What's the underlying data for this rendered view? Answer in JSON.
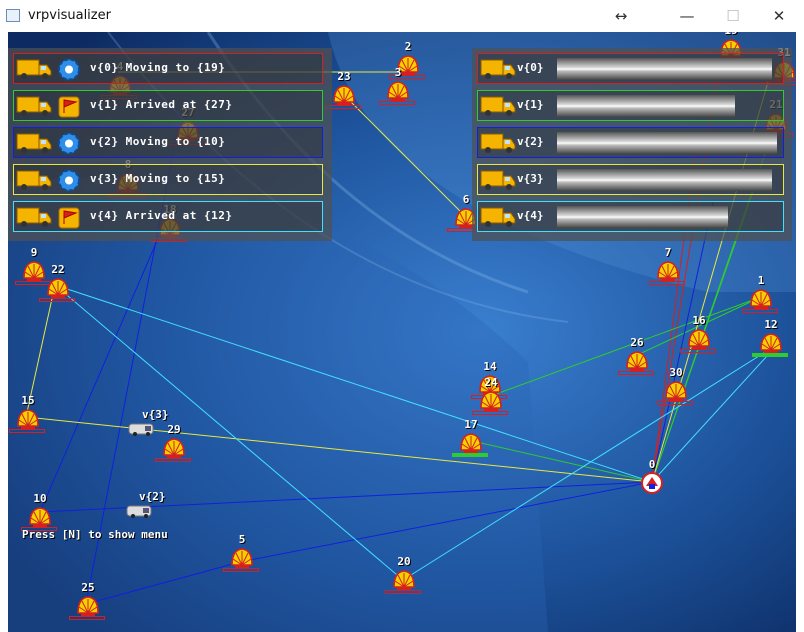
{
  "window": {
    "title": "vrpvisualizer",
    "resize_glyph": "↔",
    "minimize_glyph": "—",
    "maximize_glyph": "☐",
    "close_glyph": "✕"
  },
  "colors": {
    "background": "#1b4f97",
    "red": "#d42020",
    "green": "#2ecc2e",
    "blue": "#1020e0",
    "yellow": "#e8e840",
    "cyan": "#40e0ff",
    "white": "#ffffff"
  },
  "status_panel": {
    "rows": [
      {
        "text": "v{0} Moving to {19}",
        "state_icon": "gear-icon",
        "border": "#d42020"
      },
      {
        "text": "v{1} Arrived at {27}",
        "state_icon": "flag-icon",
        "border": "#2ecc2e"
      },
      {
        "text": "v{2} Moving to {10}",
        "state_icon": "gear-icon",
        "border": "#1020e0"
      },
      {
        "text": "v{3} Moving to {15}",
        "state_icon": "gear-icon",
        "border": "#e8e840"
      },
      {
        "text": "v{4} Arrived at {12}",
        "state_icon": "flag-icon",
        "border": "#40e0ff"
      }
    ]
  },
  "progress_panel": {
    "rows": [
      {
        "text": "v{0}",
        "progress": 0.97,
        "border": "#d42020"
      },
      {
        "text": "v{1}",
        "progress": 0.8,
        "border": "#2ecc2e"
      },
      {
        "text": "v{2}",
        "progress": 0.99,
        "border": "#1020e0"
      },
      {
        "text": "v{3}",
        "progress": 0.97,
        "border": "#e8e840"
      },
      {
        "text": "v{4}",
        "progress": 0.77,
        "border": "#40e0ff"
      }
    ]
  },
  "depot": {
    "label": "0"
  },
  "customers": [
    {
      "id": "2"
    },
    {
      "id": "3"
    },
    {
      "id": "4"
    },
    {
      "id": "23"
    },
    {
      "id": "8"
    },
    {
      "id": "18"
    },
    {
      "id": "6"
    },
    {
      "id": "9"
    },
    {
      "id": "22"
    },
    {
      "id": "15"
    },
    {
      "id": "29"
    },
    {
      "id": "10"
    },
    {
      "id": "25"
    },
    {
      "id": "5"
    },
    {
      "id": "20"
    },
    {
      "id": "14"
    },
    {
      "id": "24"
    },
    {
      "id": "7"
    },
    {
      "id": "1"
    },
    {
      "id": "16"
    },
    {
      "id": "26"
    },
    {
      "id": "30"
    },
    {
      "id": "21"
    },
    {
      "id": "31"
    },
    {
      "id": "19"
    },
    {
      "id": "17"
    },
    {
      "id": "12"
    },
    {
      "id": "27"
    }
  ],
  "vehicle_labels": {
    "v3": "v{3}",
    "v2": "v{2}"
  },
  "menu_hint": "Press [N] to show menu"
}
